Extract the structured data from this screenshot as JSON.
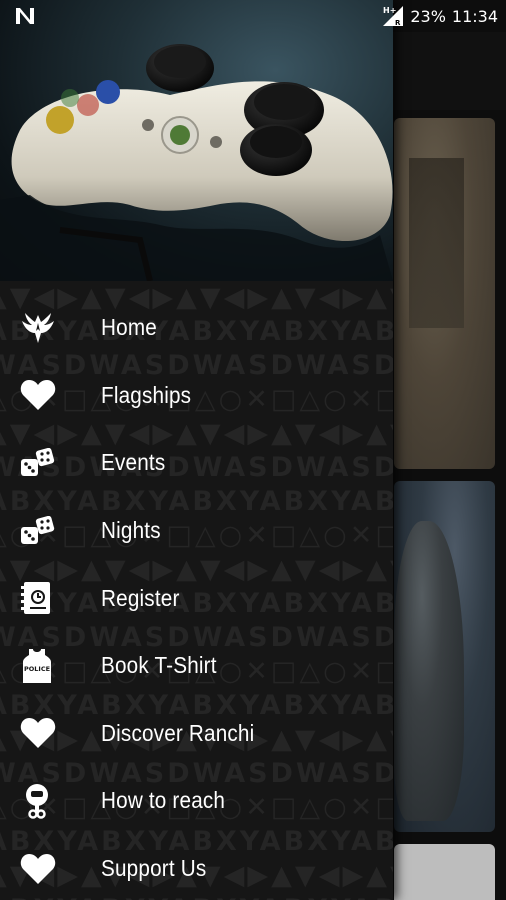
{
  "status_bar": {
    "battery": "23%",
    "time": "11:34",
    "network_type": "H+",
    "roaming": "R"
  },
  "drawer": {
    "pattern_rows": [
      "▲▼◀▶▲▼◀▶▲▼◀▶▲▼◀▶▲▼◀▶▲▼",
      "ABXYABXYABXYABXYABXYAB",
      "WASDWASDWASDWASDWASDWA",
      "△○✕□△○✕□△○✕□△○✕□△○✕□△○",
      "▲▼◀▶▲▼◀▶▲▼◀▶▲▼◀▶▲▼◀▶▲▼",
      "WASDWASDWASDWASDWASDWA",
      "ABXYABXYABXYABXYABXYAB",
      "△○✕□△○✕□△○✕□△○✕□△○✕□△○",
      "▲▼◀▶▲▼◀▶▲▼◀▶▲▼◀▶▲▼◀▶▲▼",
      "ABXYABXYABXYABXYABXYAB",
      "WASDWASDWASDWASDWASDWA",
      "△○✕□△○✕□△○✕□△○✕□△○✕□△○",
      "ABXYABXYABXYABXYABXYAB",
      "▲▼◀▶▲▼◀▶▲▼◀▶▲▼◀▶▲▼◀▶▲▼",
      "WASDWASDWASDWASDWASDWA",
      "△○✕□△○✕□△○✕□△○✕□△○✕□△○",
      "ABXYABXYABXYABXYABXYAB",
      "▲▼◀▶▲▼◀▶▲▼◀▶▲▼◀▶▲▼◀▶▲▼",
      "ABXYABXYABXYABXYABXYAB"
    ],
    "items": [
      {
        "label": "Home",
        "icon": "phoenix-logo-icon"
      },
      {
        "label": "Flagships",
        "icon": "heart-icon"
      },
      {
        "label": "Events",
        "icon": "dice-icon"
      },
      {
        "label": "Nights",
        "icon": "dice-icon"
      },
      {
        "label": "Register",
        "icon": "register-book-icon"
      },
      {
        "label": "Book T-Shirt",
        "icon": "tshirt-police-icon"
      },
      {
        "label": "Discover Ranchi",
        "icon": "heart-icon"
      },
      {
        "label": "How to reach",
        "icon": "location-pin-icon"
      },
      {
        "label": "Support Us",
        "icon": "heart-icon"
      }
    ],
    "tshirt_text": "POLICE"
  },
  "colors": {
    "drawer_background": "#161616",
    "menu_text": "#ffffff",
    "pattern_text": "#252525"
  }
}
